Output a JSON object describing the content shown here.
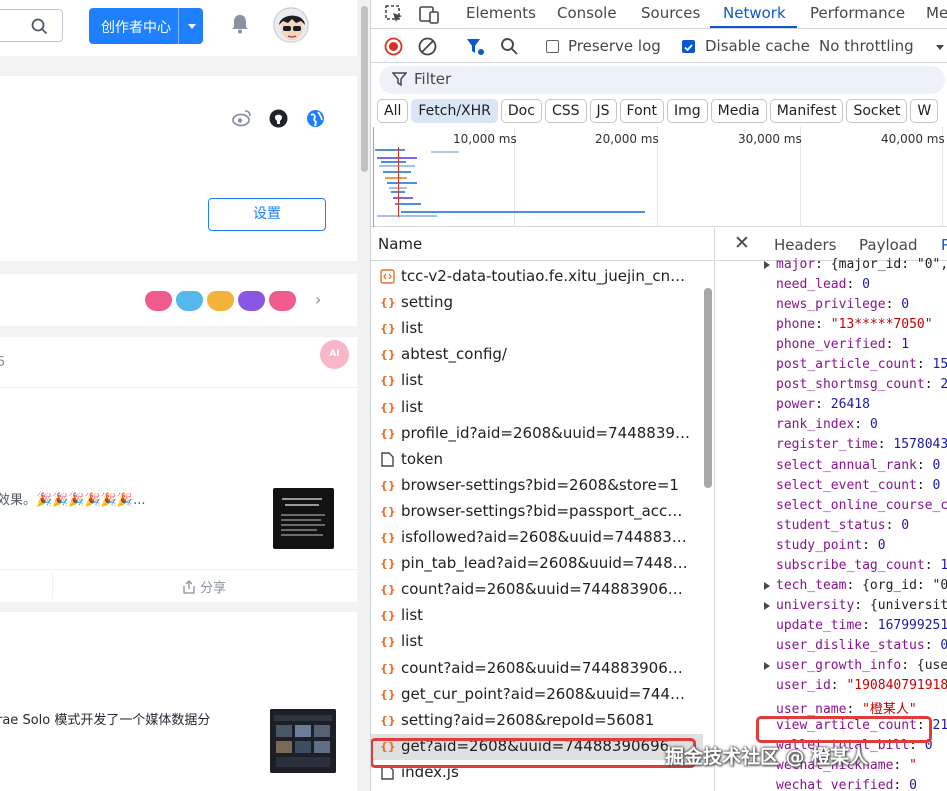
{
  "page": {
    "header": {
      "creator_button": "创作者中心"
    },
    "profile": {
      "settings_button": "设置"
    },
    "feed": {
      "partial_number": "5",
      "ai_badge": "AI",
      "excerpt": "效果。🎉🎉🎉🎉🎉🎉...",
      "thumb_text": "做参考，拼拌到配到\n看板",
      "share_label": "分享",
      "article_title": "rae Solo 模式开发了一个媒体数据分"
    },
    "colors": {
      "brand": "#1e80ff",
      "badge_pink": "#f05a8c",
      "badge_blue": "#55b7ee",
      "badge_gold": "#f3b33b",
      "badge_purple": "#8a57e2"
    }
  },
  "devtools": {
    "tabs": [
      "Elements",
      "Console",
      "Sources",
      "Network",
      "Performance",
      "Me"
    ],
    "active_tab": "Network",
    "toolbar": {
      "preserve_log": "Preserve log",
      "disable_cache": "Disable cache",
      "throttling": "No throttling"
    },
    "filter_placeholder": "Filter",
    "type_filters": [
      "All",
      "Fetch/XHR",
      "Doc",
      "CSS",
      "JS",
      "Font",
      "Img",
      "Media",
      "Manifest",
      "Socket",
      "W"
    ],
    "active_filter": "Fetch/XHR",
    "timeline_labels": [
      "10,000 ms",
      "20,000 ms",
      "30,000 ms",
      "40,000 ms"
    ],
    "name_header": "Name",
    "requests": [
      {
        "name": "tcc-v2-data-toutiao.fe.xitu_juejin_cn_w...",
        "type": "script"
      },
      {
        "name": "setting",
        "type": "xhr"
      },
      {
        "name": "list",
        "type": "xhr"
      },
      {
        "name": "abtest_config/",
        "type": "xhr"
      },
      {
        "name": "list",
        "type": "xhr"
      },
      {
        "name": "list",
        "type": "xhr"
      },
      {
        "name": "profile_id?aid=2608&uuid=744883906...",
        "type": "xhr"
      },
      {
        "name": "token",
        "type": "doc"
      },
      {
        "name": "browser-settings?bid=2608&store=1",
        "type": "xhr"
      },
      {
        "name": "browser-settings?bid=passport_accoun...",
        "type": "xhr"
      },
      {
        "name": "isfollowed?aid=2608&uuid=74488390...",
        "type": "xhr"
      },
      {
        "name": "pin_tab_lead?aid=2608&uuid=744883...",
        "type": "xhr"
      },
      {
        "name": "count?aid=2608&uuid=744883906964...",
        "type": "xhr"
      },
      {
        "name": "list",
        "type": "xhr"
      },
      {
        "name": "list",
        "type": "xhr"
      },
      {
        "name": "count?aid=2608&uuid=744883906964...",
        "type": "xhr"
      },
      {
        "name": "get_cur_point?aid=2608&uuid=744883...",
        "type": "xhr"
      },
      {
        "name": "setting?aid=2608&repoId=56081",
        "type": "xhr"
      },
      {
        "name": "get?aid=2608&uuid=744883906964...",
        "type": "xhr"
      },
      {
        "name": "index.js",
        "type": "doc"
      }
    ],
    "selected_request": 18,
    "detail_tabs": [
      "Headers",
      "Payload",
      "P"
    ],
    "properties": [
      {
        "key": "major",
        "val": "{major_id: \"0\",",
        "kind": "obj",
        "expand": true
      },
      {
        "key": "need_lead",
        "val": "0",
        "kind": "num"
      },
      {
        "key": "news_privilege",
        "val": "0",
        "kind": "num"
      },
      {
        "key": "phone",
        "val": "\"13*****7050\"",
        "kind": "str"
      },
      {
        "key": "phone_verified",
        "val": "1",
        "kind": "num"
      },
      {
        "key": "post_article_count",
        "val": "15",
        "kind": "num"
      },
      {
        "key": "post_shortmsg_count",
        "val": "2",
        "kind": "num"
      },
      {
        "key": "power",
        "val": "26418",
        "kind": "num"
      },
      {
        "key": "rank_index",
        "val": "0",
        "kind": "num"
      },
      {
        "key": "register_time",
        "val": "1578043",
        "kind": "num"
      },
      {
        "key": "select_annual_rank",
        "val": "0",
        "kind": "num"
      },
      {
        "key": "select_event_count",
        "val": "0",
        "kind": "num"
      },
      {
        "key": "select_online_course_c",
        "val": "",
        "kind": "num"
      },
      {
        "key": "student_status",
        "val": "0",
        "kind": "num"
      },
      {
        "key": "study_point",
        "val": "0",
        "kind": "num"
      },
      {
        "key": "subscribe_tag_count",
        "val": "1",
        "kind": "num"
      },
      {
        "key": "tech_team",
        "val": "{org_id: \"0",
        "kind": "obj",
        "expand": true
      },
      {
        "key": "university",
        "val": "{universit",
        "kind": "obj",
        "expand": true
      },
      {
        "key": "update_time",
        "val": "167999251",
        "kind": "num"
      },
      {
        "key": "user_dislike_status",
        "val": "0",
        "kind": "num"
      },
      {
        "key": "user_growth_info",
        "val": "{use",
        "kind": "obj",
        "expand": true
      },
      {
        "key": "user_id",
        "val": "\"190840791918",
        "kind": "str"
      },
      {
        "key": "user_name",
        "val": "\"橙某人\"",
        "kind": "str"
      },
      {
        "key": "view_article_count",
        "val": "21",
        "kind": "num"
      },
      {
        "key": "wallet_total_bill",
        "val": "0",
        "kind": "num"
      },
      {
        "key": "wechat_nickname",
        "val": "\"",
        "kind": "str"
      },
      {
        "key": "wechat_verified",
        "val": "0",
        "kind": "num"
      }
    ],
    "colors": {
      "accent": "#0b57d0",
      "record": "#d93025",
      "highlight": "#e03c3c"
    }
  },
  "watermark": "掘金技术社区 @ 橙某人"
}
